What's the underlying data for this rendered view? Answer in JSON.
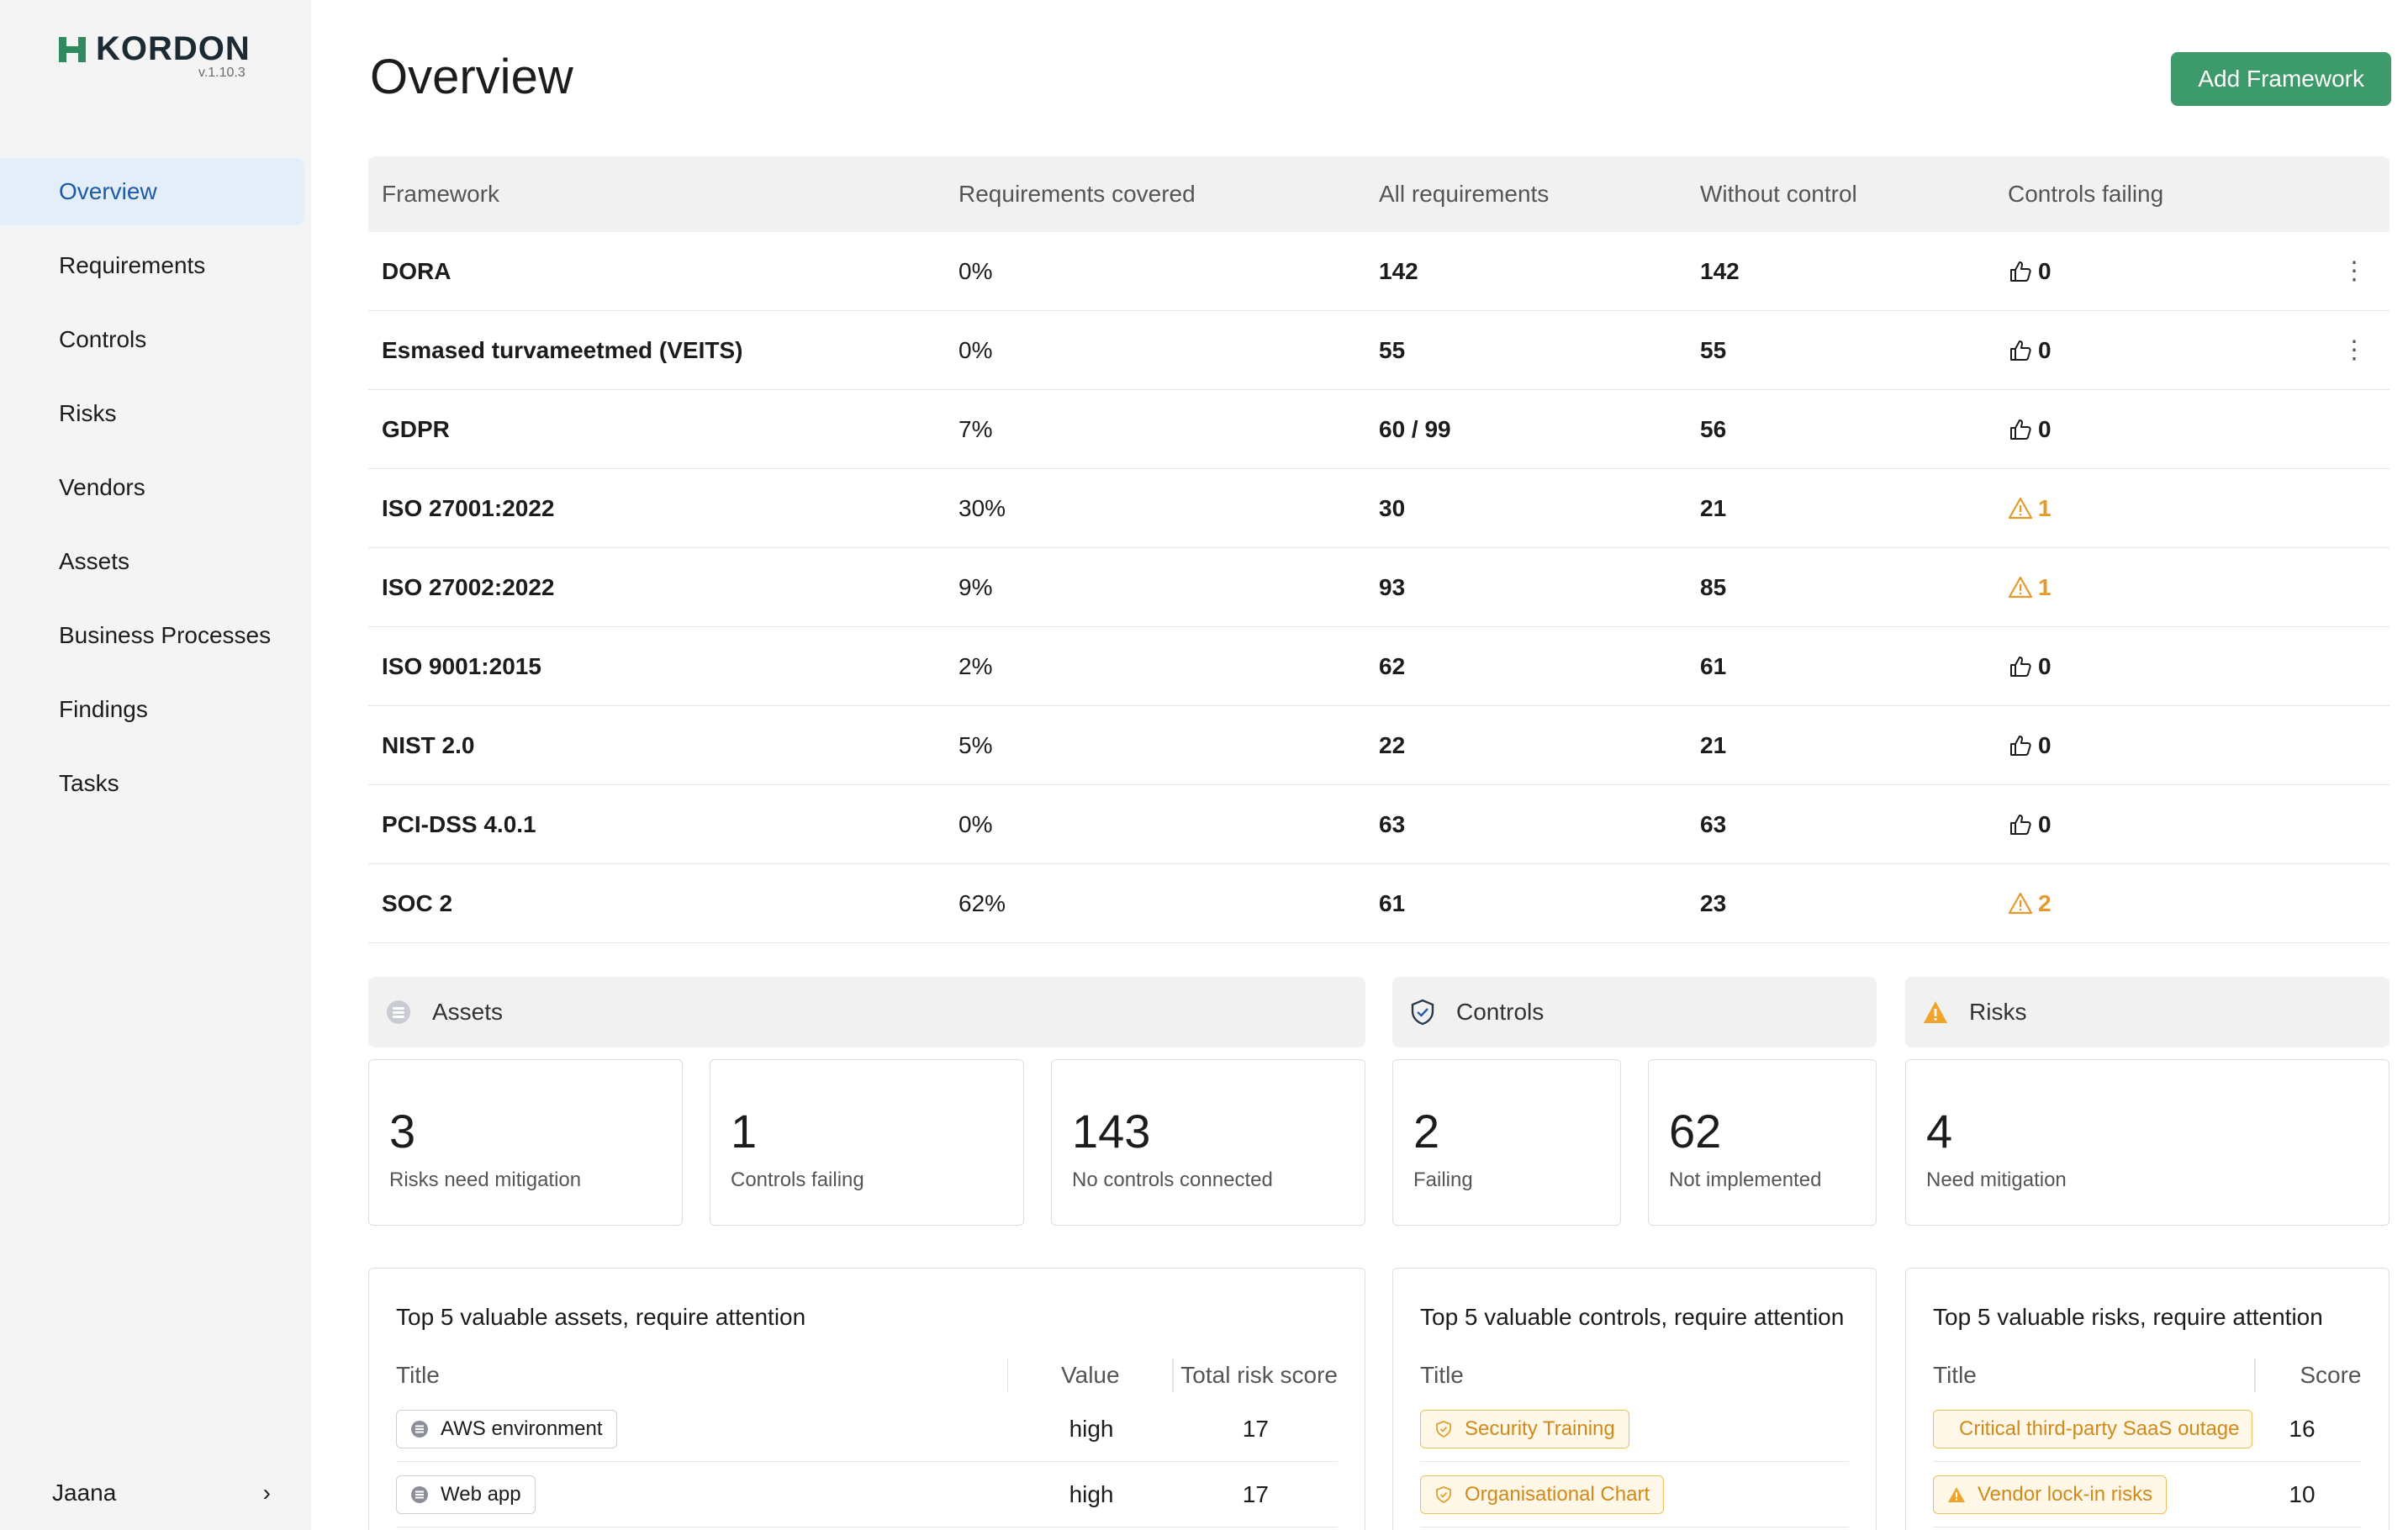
{
  "brand": {
    "name": "KORDON",
    "version": "v.1.10.3"
  },
  "sidebar": {
    "items": [
      {
        "label": "Overview",
        "active": true
      },
      {
        "label": "Requirements"
      },
      {
        "label": "Controls"
      },
      {
        "label": "Risks"
      },
      {
        "label": "Vendors"
      },
      {
        "label": "Assets"
      },
      {
        "label": "Business Processes"
      },
      {
        "label": "Findings"
      },
      {
        "label": "Tasks"
      }
    ],
    "user": {
      "name": "Jaana"
    }
  },
  "header": {
    "title": "Overview",
    "add_button": "Add Framework"
  },
  "frameworks": {
    "columns": [
      "Framework",
      "Requirements covered",
      "All requirements",
      "Without control",
      "Controls failing"
    ],
    "rows": [
      {
        "name": "DORA",
        "covered": "0%",
        "all": "142",
        "without": "142",
        "failing": "0",
        "failing_icon": "thumbs-up-icon",
        "menu": true
      },
      {
        "name": "Esmased turvameetmed (VEITS)",
        "covered": "0%",
        "all": "55",
        "without": "55",
        "failing": "0",
        "failing_icon": "thumbs-up-icon",
        "menu": true
      },
      {
        "name": "GDPR",
        "covered": "7%",
        "all": "60 / 99",
        "without": "56",
        "failing": "0",
        "failing_icon": "thumbs-up-icon"
      },
      {
        "name": "ISO 27001:2022",
        "covered": "30%",
        "all": "30",
        "without": "21",
        "failing": "1",
        "failing_icon": "warning-icon"
      },
      {
        "name": "ISO 27002:2022",
        "covered": "9%",
        "all": "93",
        "without": "85",
        "failing": "1",
        "failing_icon": "warning-icon"
      },
      {
        "name": "ISO 9001:2015",
        "covered": "2%",
        "all": "62",
        "without": "61",
        "failing": "0",
        "failing_icon": "thumbs-up-icon"
      },
      {
        "name": "NIST 2.0",
        "covered": "5%",
        "all": "22",
        "without": "21",
        "failing": "0",
        "failing_icon": "thumbs-up-icon"
      },
      {
        "name": "PCI-DSS 4.0.1",
        "covered": "0%",
        "all": "63",
        "without": "63",
        "failing": "0",
        "failing_icon": "thumbs-up-icon"
      },
      {
        "name": "SOC 2",
        "covered": "62%",
        "all": "61",
        "without": "23",
        "failing": "2",
        "failing_icon": "warning-icon"
      }
    ]
  },
  "sections": {
    "assets": {
      "title": "Assets",
      "cards": [
        {
          "value": "3",
          "label": "Risks need mitigation"
        },
        {
          "value": "1",
          "label": "Controls failing"
        },
        {
          "value": "143",
          "label": "No controls connected"
        }
      ]
    },
    "controls": {
      "title": "Controls",
      "cards": [
        {
          "value": "2",
          "label": "Failing"
        },
        {
          "value": "62",
          "label": "Not implemented"
        }
      ]
    },
    "risks": {
      "title": "Risks",
      "cards": [
        {
          "value": "4",
          "label": "Need mitigation"
        }
      ]
    }
  },
  "panels": {
    "assets": {
      "title": "Top 5 valuable assets, require attention",
      "columns": [
        "Title",
        "Value",
        "Total risk score"
      ],
      "rows": [
        {
          "title": "AWS environment",
          "value": "high",
          "score": "17"
        },
        {
          "title": "Web app",
          "value": "high",
          "score": "17"
        }
      ]
    },
    "controls": {
      "title": "Top 5 valuable controls, require attention",
      "columns": [
        "Title"
      ],
      "rows": [
        {
          "title": "Security Training"
        },
        {
          "title": "Organisational Chart"
        }
      ]
    },
    "risks": {
      "title": "Top 5 valuable risks, require attention",
      "columns": [
        "Title",
        "Score"
      ],
      "rows": [
        {
          "title": "Critical third-party SaaS outage",
          "score": "16"
        },
        {
          "title": "Vendor lock-in risks",
          "score": "10"
        }
      ]
    }
  },
  "colors": {
    "accent": "#3d9a6a",
    "active_nav_bg": "#e3eef9",
    "active_nav_text": "#1e5aa8",
    "warning": "#e39a2a"
  }
}
